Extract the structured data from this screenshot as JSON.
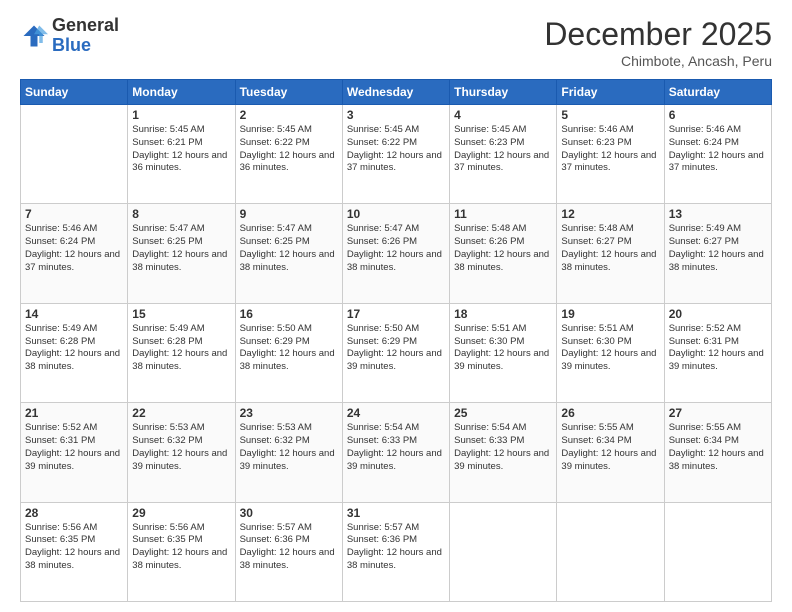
{
  "logo": {
    "general": "General",
    "blue": "Blue"
  },
  "header": {
    "title": "December 2025",
    "subtitle": "Chimbote, Ancash, Peru"
  },
  "weekdays": [
    "Sunday",
    "Monday",
    "Tuesday",
    "Wednesday",
    "Thursday",
    "Friday",
    "Saturday"
  ],
  "weeks": [
    [
      {
        "day": "",
        "sunrise": "",
        "sunset": "",
        "daylight": ""
      },
      {
        "day": "1",
        "sunrise": "Sunrise: 5:45 AM",
        "sunset": "Sunset: 6:21 PM",
        "daylight": "Daylight: 12 hours and 36 minutes."
      },
      {
        "day": "2",
        "sunrise": "Sunrise: 5:45 AM",
        "sunset": "Sunset: 6:22 PM",
        "daylight": "Daylight: 12 hours and 36 minutes."
      },
      {
        "day": "3",
        "sunrise": "Sunrise: 5:45 AM",
        "sunset": "Sunset: 6:22 PM",
        "daylight": "Daylight: 12 hours and 37 minutes."
      },
      {
        "day": "4",
        "sunrise": "Sunrise: 5:45 AM",
        "sunset": "Sunset: 6:23 PM",
        "daylight": "Daylight: 12 hours and 37 minutes."
      },
      {
        "day": "5",
        "sunrise": "Sunrise: 5:46 AM",
        "sunset": "Sunset: 6:23 PM",
        "daylight": "Daylight: 12 hours and 37 minutes."
      },
      {
        "day": "6",
        "sunrise": "Sunrise: 5:46 AM",
        "sunset": "Sunset: 6:24 PM",
        "daylight": "Daylight: 12 hours and 37 minutes."
      }
    ],
    [
      {
        "day": "7",
        "sunrise": "Sunrise: 5:46 AM",
        "sunset": "Sunset: 6:24 PM",
        "daylight": "Daylight: 12 hours and 37 minutes."
      },
      {
        "day": "8",
        "sunrise": "Sunrise: 5:47 AM",
        "sunset": "Sunset: 6:25 PM",
        "daylight": "Daylight: 12 hours and 38 minutes."
      },
      {
        "day": "9",
        "sunrise": "Sunrise: 5:47 AM",
        "sunset": "Sunset: 6:25 PM",
        "daylight": "Daylight: 12 hours and 38 minutes."
      },
      {
        "day": "10",
        "sunrise": "Sunrise: 5:47 AM",
        "sunset": "Sunset: 6:26 PM",
        "daylight": "Daylight: 12 hours and 38 minutes."
      },
      {
        "day": "11",
        "sunrise": "Sunrise: 5:48 AM",
        "sunset": "Sunset: 6:26 PM",
        "daylight": "Daylight: 12 hours and 38 minutes."
      },
      {
        "day": "12",
        "sunrise": "Sunrise: 5:48 AM",
        "sunset": "Sunset: 6:27 PM",
        "daylight": "Daylight: 12 hours and 38 minutes."
      },
      {
        "day": "13",
        "sunrise": "Sunrise: 5:49 AM",
        "sunset": "Sunset: 6:27 PM",
        "daylight": "Daylight: 12 hours and 38 minutes."
      }
    ],
    [
      {
        "day": "14",
        "sunrise": "Sunrise: 5:49 AM",
        "sunset": "Sunset: 6:28 PM",
        "daylight": "Daylight: 12 hours and 38 minutes."
      },
      {
        "day": "15",
        "sunrise": "Sunrise: 5:49 AM",
        "sunset": "Sunset: 6:28 PM",
        "daylight": "Daylight: 12 hours and 38 minutes."
      },
      {
        "day": "16",
        "sunrise": "Sunrise: 5:50 AM",
        "sunset": "Sunset: 6:29 PM",
        "daylight": "Daylight: 12 hours and 38 minutes."
      },
      {
        "day": "17",
        "sunrise": "Sunrise: 5:50 AM",
        "sunset": "Sunset: 6:29 PM",
        "daylight": "Daylight: 12 hours and 39 minutes."
      },
      {
        "day": "18",
        "sunrise": "Sunrise: 5:51 AM",
        "sunset": "Sunset: 6:30 PM",
        "daylight": "Daylight: 12 hours and 39 minutes."
      },
      {
        "day": "19",
        "sunrise": "Sunrise: 5:51 AM",
        "sunset": "Sunset: 6:30 PM",
        "daylight": "Daylight: 12 hours and 39 minutes."
      },
      {
        "day": "20",
        "sunrise": "Sunrise: 5:52 AM",
        "sunset": "Sunset: 6:31 PM",
        "daylight": "Daylight: 12 hours and 39 minutes."
      }
    ],
    [
      {
        "day": "21",
        "sunrise": "Sunrise: 5:52 AM",
        "sunset": "Sunset: 6:31 PM",
        "daylight": "Daylight: 12 hours and 39 minutes."
      },
      {
        "day": "22",
        "sunrise": "Sunrise: 5:53 AM",
        "sunset": "Sunset: 6:32 PM",
        "daylight": "Daylight: 12 hours and 39 minutes."
      },
      {
        "day": "23",
        "sunrise": "Sunrise: 5:53 AM",
        "sunset": "Sunset: 6:32 PM",
        "daylight": "Daylight: 12 hours and 39 minutes."
      },
      {
        "day": "24",
        "sunrise": "Sunrise: 5:54 AM",
        "sunset": "Sunset: 6:33 PM",
        "daylight": "Daylight: 12 hours and 39 minutes."
      },
      {
        "day": "25",
        "sunrise": "Sunrise: 5:54 AM",
        "sunset": "Sunset: 6:33 PM",
        "daylight": "Daylight: 12 hours and 39 minutes."
      },
      {
        "day": "26",
        "sunrise": "Sunrise: 5:55 AM",
        "sunset": "Sunset: 6:34 PM",
        "daylight": "Daylight: 12 hours and 39 minutes."
      },
      {
        "day": "27",
        "sunrise": "Sunrise: 5:55 AM",
        "sunset": "Sunset: 6:34 PM",
        "daylight": "Daylight: 12 hours and 38 minutes."
      }
    ],
    [
      {
        "day": "28",
        "sunrise": "Sunrise: 5:56 AM",
        "sunset": "Sunset: 6:35 PM",
        "daylight": "Daylight: 12 hours and 38 minutes."
      },
      {
        "day": "29",
        "sunrise": "Sunrise: 5:56 AM",
        "sunset": "Sunset: 6:35 PM",
        "daylight": "Daylight: 12 hours and 38 minutes."
      },
      {
        "day": "30",
        "sunrise": "Sunrise: 5:57 AM",
        "sunset": "Sunset: 6:36 PM",
        "daylight": "Daylight: 12 hours and 38 minutes."
      },
      {
        "day": "31",
        "sunrise": "Sunrise: 5:57 AM",
        "sunset": "Sunset: 6:36 PM",
        "daylight": "Daylight: 12 hours and 38 minutes."
      },
      {
        "day": "",
        "sunrise": "",
        "sunset": "",
        "daylight": ""
      },
      {
        "day": "",
        "sunrise": "",
        "sunset": "",
        "daylight": ""
      },
      {
        "day": "",
        "sunrise": "",
        "sunset": "",
        "daylight": ""
      }
    ]
  ]
}
